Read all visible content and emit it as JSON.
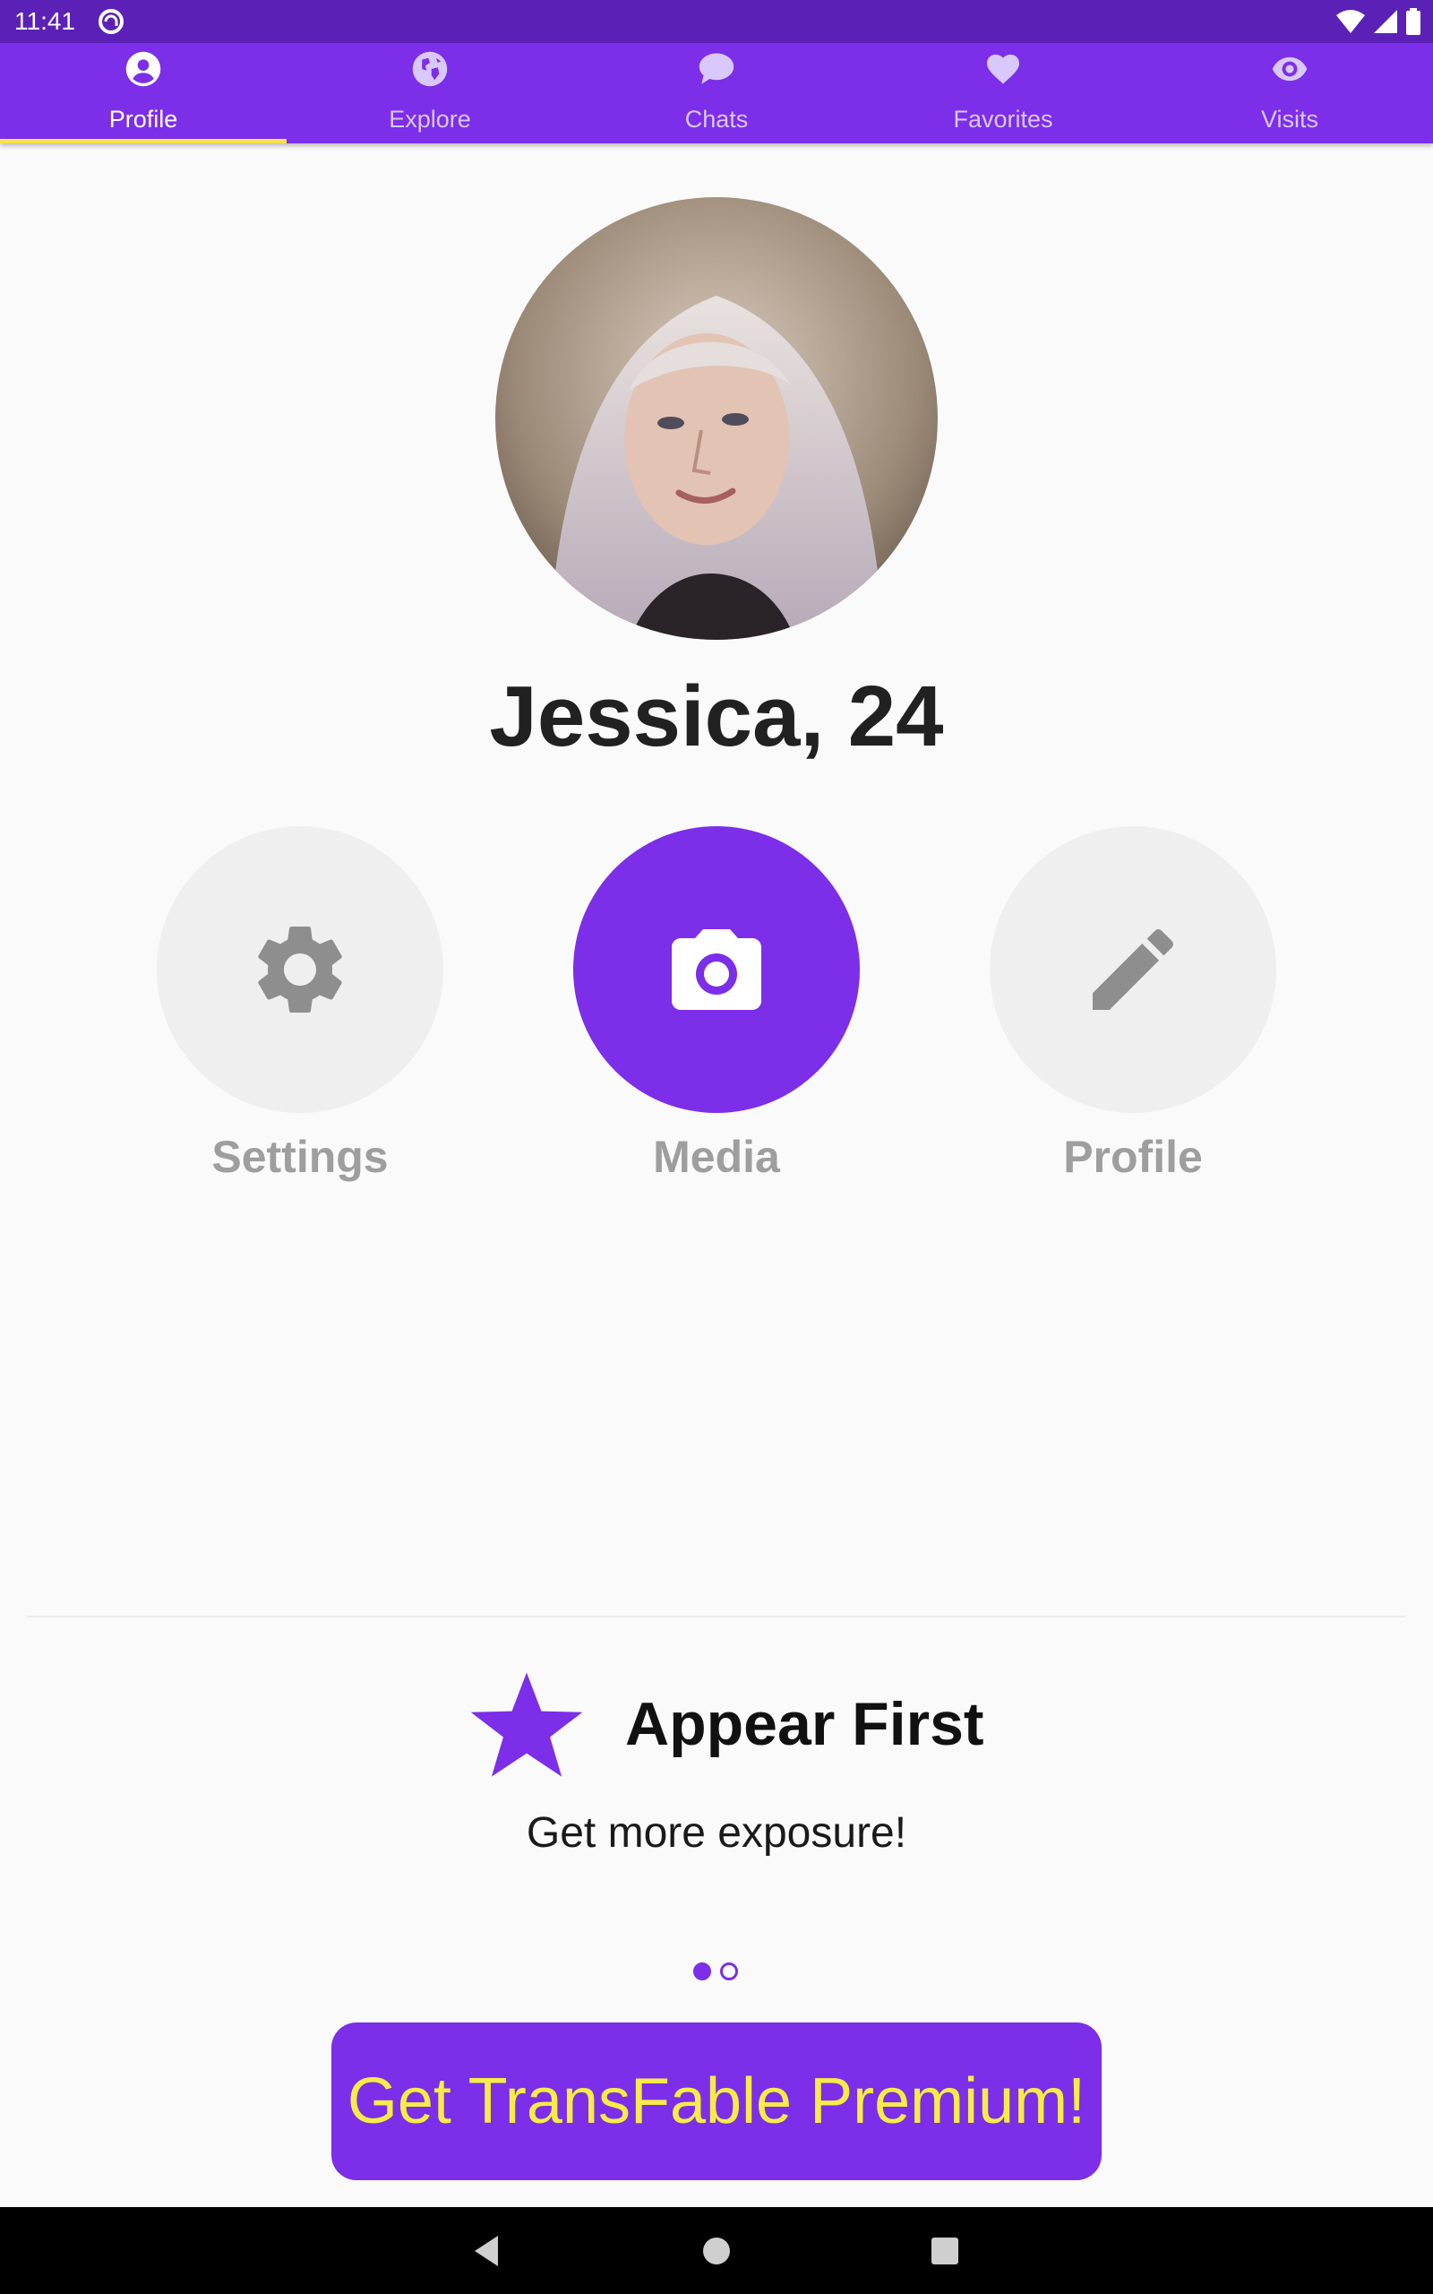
{
  "status_bar": {
    "time": "11:41"
  },
  "tabs": [
    {
      "label": "Profile",
      "icon": "account-circle-icon",
      "active": true
    },
    {
      "label": "Explore",
      "icon": "globe-icon",
      "active": false
    },
    {
      "label": "Chats",
      "icon": "chat-bubble-icon",
      "active": false
    },
    {
      "label": "Favorites",
      "icon": "heart-icon",
      "active": false
    },
    {
      "label": "Visits",
      "icon": "eye-icon",
      "active": false
    }
  ],
  "profile": {
    "name": "Jessica, 24"
  },
  "actions": [
    {
      "label": "Settings",
      "icon": "gear-icon",
      "primary": false
    },
    {
      "label": "Media",
      "icon": "camera-icon",
      "primary": true
    },
    {
      "label": "Profile",
      "icon": "pencil-icon",
      "primary": false
    }
  ],
  "promo": {
    "icon": "star-icon",
    "title": "Appear First",
    "subtitle": "Get more exposure!",
    "page_count": 2,
    "current_page": 1
  },
  "premium": {
    "label": "Get TransFable Premium!"
  },
  "colors": {
    "accent": "#7c2ee8",
    "status_bar": "#5b21b6",
    "tab_indicator": "#f7e24b",
    "button_text": "#f7ec46",
    "neutral_circle": "#efefef",
    "neutral_icon": "#8e8e8e"
  }
}
